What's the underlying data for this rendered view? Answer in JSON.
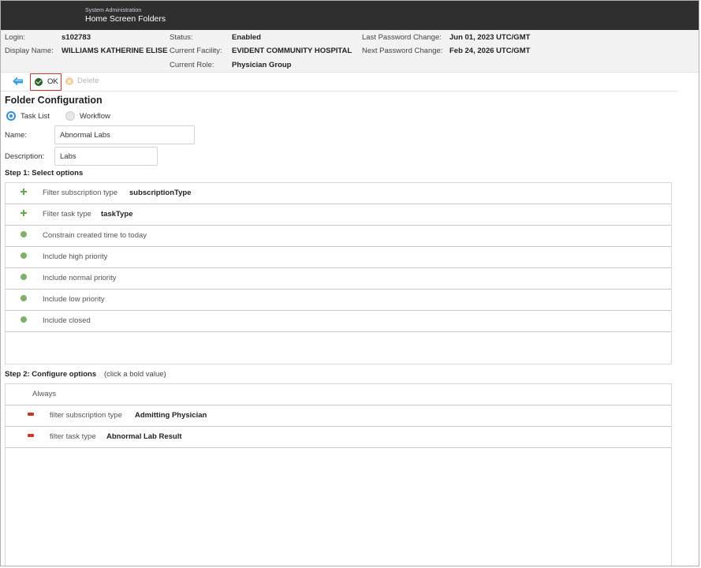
{
  "header": {
    "subtitle": "System Administration",
    "title": "Home Screen Folders"
  },
  "info": {
    "login_label": "Login:",
    "login_value": "s102783",
    "display_name_label": "Display Name:",
    "display_name_value": "WILLIAMS KATHERINE ELISE",
    "status_label": "Status:",
    "status_value": "Enabled",
    "facility_label": "Current Facility:",
    "facility_value": "EVIDENT COMMUNITY HOSPITAL",
    "role_label": "Current Role:",
    "role_value": "Physician Group",
    "last_pw_label": "Last Password Change:",
    "last_pw_value": "Jun 01, 2023 UTC/GMT",
    "next_pw_label": "Next Password Change:",
    "next_pw_value": "Feb 24, 2026 UTC/GMT"
  },
  "toolbar": {
    "ok_label": "OK",
    "delete_label": "Delete"
  },
  "form": {
    "title": "Folder Configuration",
    "radio_task_list": "Task List",
    "radio_workflow": "Workflow",
    "selected_type": "Task List",
    "name_label": "Name:",
    "name_value": "Abnormal Labs",
    "description_label": "Description:",
    "description_value": "Labs"
  },
  "step1": {
    "label": "Step 1: Select options",
    "options": [
      {
        "icon": "plus-icon",
        "text": "Filter subscription type",
        "bold": "subscriptionType"
      },
      {
        "icon": "plus-icon",
        "text": "Filter task type",
        "bold": "taskType"
      },
      {
        "icon": "dot-icon",
        "text": "Constrain created time to today",
        "bold": ""
      },
      {
        "icon": "dot-icon",
        "text": "Include high priority",
        "bold": ""
      },
      {
        "icon": "dot-icon",
        "text": "Include normal priority",
        "bold": ""
      },
      {
        "icon": "dot-icon",
        "text": "Include low priority",
        "bold": ""
      },
      {
        "icon": "dot-icon",
        "text": "Include closed",
        "bold": ""
      }
    ]
  },
  "step2": {
    "label": "Step 2: Configure options",
    "hint": "(click a bold value)",
    "always": "Always",
    "options": [
      {
        "icon": "minus-icon",
        "text": "filter subscription type",
        "bold": "Admitting Physician"
      },
      {
        "icon": "minus-icon",
        "text": "filter task type",
        "bold": "Abnormal Lab Result"
      }
    ]
  },
  "colors": {
    "header_bg": "#2f2f2f",
    "info_bg": "#f2f2f2",
    "accent_blue": "#3a8fcf",
    "ok_highlight": "#c0392b",
    "add_green": "#6aa84f",
    "remove_red": "#c0392b"
  }
}
